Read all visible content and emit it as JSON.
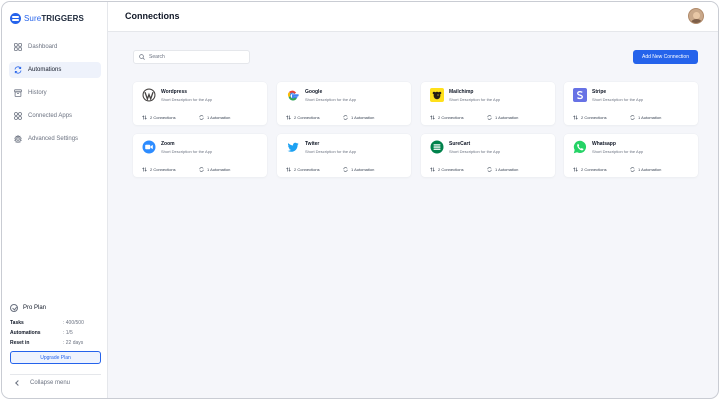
{
  "brand": {
    "sure": "Sure",
    "triggers": "TRIGGERS"
  },
  "sidebar": {
    "items": [
      {
        "label": "Dashboard",
        "icon": "grid-icon"
      },
      {
        "label": "Automations",
        "icon": "refresh-icon"
      },
      {
        "label": "History",
        "icon": "history-icon"
      },
      {
        "label": "Connected Apps",
        "icon": "apps-icon"
      },
      {
        "label": "Advanced Settings",
        "icon": "gear-icon"
      }
    ],
    "active_index": 1,
    "plan": {
      "title": "Pro Plan",
      "rows": [
        {
          "key": "Tasks",
          "value": ": 400/500"
        },
        {
          "key": "Automations",
          "value": ": 1/5"
        },
        {
          "key": "Reset in",
          "value": ": 22 days"
        }
      ],
      "upgrade_label": "Upgrade Plan"
    },
    "collapse_label": "Collapse menu"
  },
  "header": {
    "title": "Connections"
  },
  "toolbar": {
    "search_placeholder": "Search",
    "add_label": "Add New Connection"
  },
  "colors": {
    "accent": "#2563eb"
  },
  "cards": [
    {
      "name": "Wordpress",
      "desc": "Short Description for the App",
      "connections": "2 Connections",
      "automations": "1 Automation",
      "icon": "wordpress-icon"
    },
    {
      "name": "Google",
      "desc": "Short Description for the App",
      "connections": "2 Connections",
      "automations": "1 Automation",
      "icon": "google-icon"
    },
    {
      "name": "Mailchimp",
      "desc": "Short Description for the App",
      "connections": "2 Connections",
      "automations": "1 Automation",
      "icon": "mailchimp-icon"
    },
    {
      "name": "Stripe",
      "desc": "Short Description for the App",
      "connections": "2 Connections",
      "automations": "1 Automation",
      "icon": "stripe-icon"
    },
    {
      "name": "Zoom",
      "desc": "Short Description for the App",
      "connections": "2 Connections",
      "automations": "1 Automation",
      "icon": "zoom-icon"
    },
    {
      "name": "Twiter",
      "desc": "Short Description for the App",
      "connections": "2 Connections",
      "automations": "1 Automation",
      "icon": "twitter-icon"
    },
    {
      "name": "SureCart",
      "desc": "Short Description for the App",
      "connections": "2 Connections",
      "automations": "1 Automation",
      "icon": "surecart-icon"
    },
    {
      "name": "Whatsapp",
      "desc": "Short Description for the App",
      "connections": "2 Connections",
      "automations": "1 Automation",
      "icon": "whatsapp-icon"
    }
  ]
}
